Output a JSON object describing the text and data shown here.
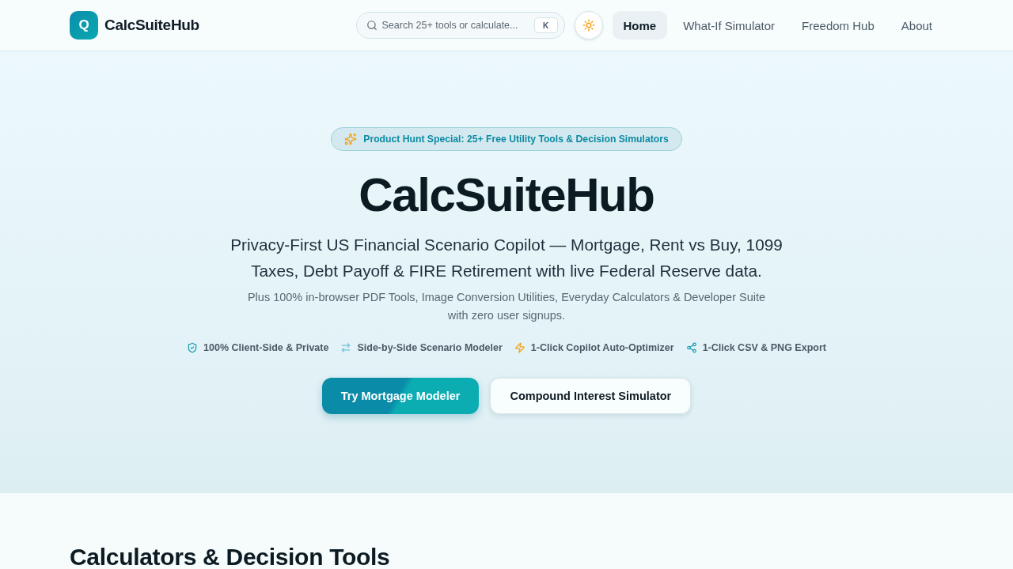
{
  "header": {
    "logo": {
      "letter": "Q",
      "name": "CalcSuiteHub"
    },
    "search": {
      "placeholder": "Search 25+ tools or calculate...",
      "shortcut": "K"
    },
    "nav": [
      {
        "label": "Home",
        "selected": true
      },
      {
        "label": "What-If Simulator",
        "selected": false
      },
      {
        "label": "Freedom Hub",
        "selected": false
      },
      {
        "label": "About",
        "selected": false
      }
    ]
  },
  "hero": {
    "badge": "Product Hunt Special: 25+ Free Utility Tools & Decision Simulators",
    "title": "CalcSuiteHub",
    "subtitle": "Privacy-First US Financial Scenario Copilot — Mortgage, Rent vs Buy, 1099 Taxes, Debt Payoff & FIRE Retirement with live Federal Reserve data.",
    "description": "Plus 100% in-browser PDF Tools, Image Conversion Utilities, Everyday Calculators & Developer Suite with zero user signups.",
    "features": [
      {
        "kind": "shield",
        "label": "100% Client-Side & Private"
      },
      {
        "kind": "swap",
        "label": "Side-by-Side Scenario Modeler"
      },
      {
        "kind": "bolt",
        "label": "1-Click Copilot Auto-Optimizer"
      },
      {
        "kind": "share",
        "label": "1-Click CSV & PNG Export"
      }
    ],
    "buttons": [
      {
        "kind": "primary",
        "label": "Try Mortgage Modeler"
      },
      {
        "kind": "secondary",
        "label": "Compound Interest Simulator"
      }
    ]
  },
  "section": {
    "heading": "Calculators & Decision Tools"
  }
}
